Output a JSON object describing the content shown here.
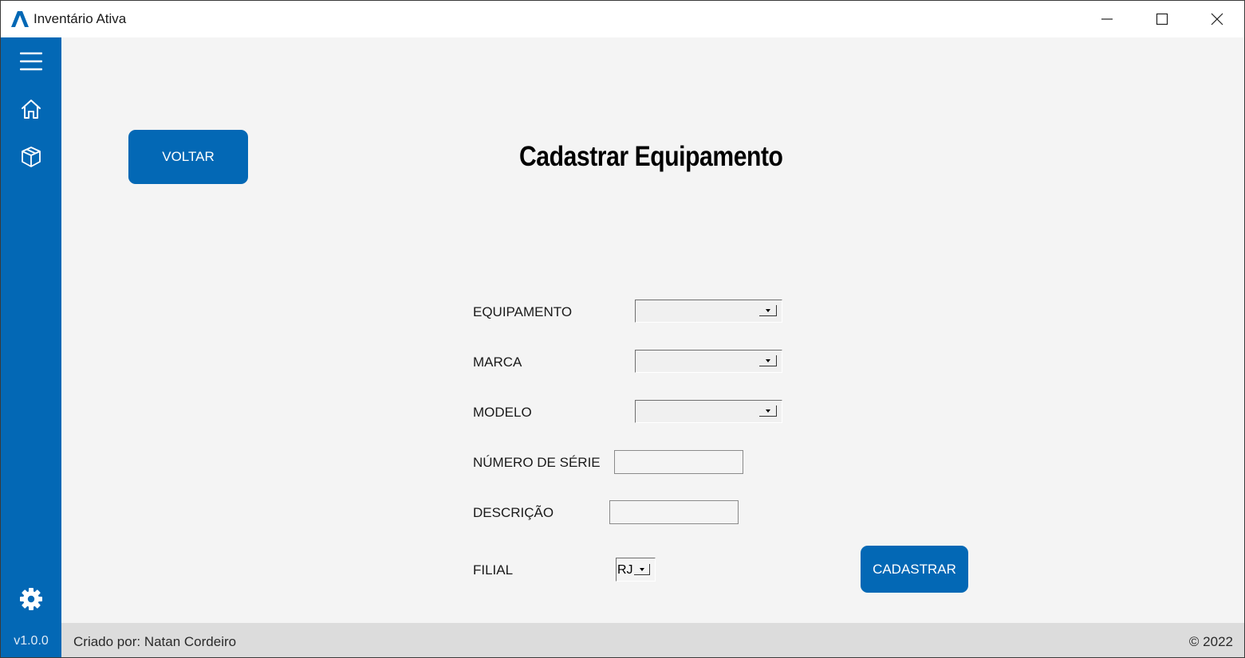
{
  "window": {
    "title": "Inventário Ativa",
    "controls": [
      "minimize-icon",
      "maximize-icon",
      "close-icon"
    ]
  },
  "sidebar": {
    "icons": [
      "menu-icon",
      "home-icon",
      "box-icon",
      "gear-icon"
    ],
    "version": "v1.0.0",
    "color": "#0368b5"
  },
  "main": {
    "back_button": "VOLTAR",
    "title": "Cadastrar Equipamento",
    "form": {
      "equipamento_label": "EQUIPAMENTO",
      "equipamento_value": "",
      "marca_label": "MARCA",
      "marca_value": "",
      "modelo_label": "MODELO",
      "modelo_value": "",
      "serie_label": "NÚMERO DE SÉRIE",
      "serie_value": "",
      "descricao_label": "DESCRIÇÃO",
      "descricao_value": "",
      "filial_label": "FILIAL",
      "filial_value": "RJ"
    },
    "submit_button": "CADASTRAR"
  },
  "footer": {
    "author": "Criado por: Natan Cordeiro",
    "copyright": "© 2022"
  }
}
